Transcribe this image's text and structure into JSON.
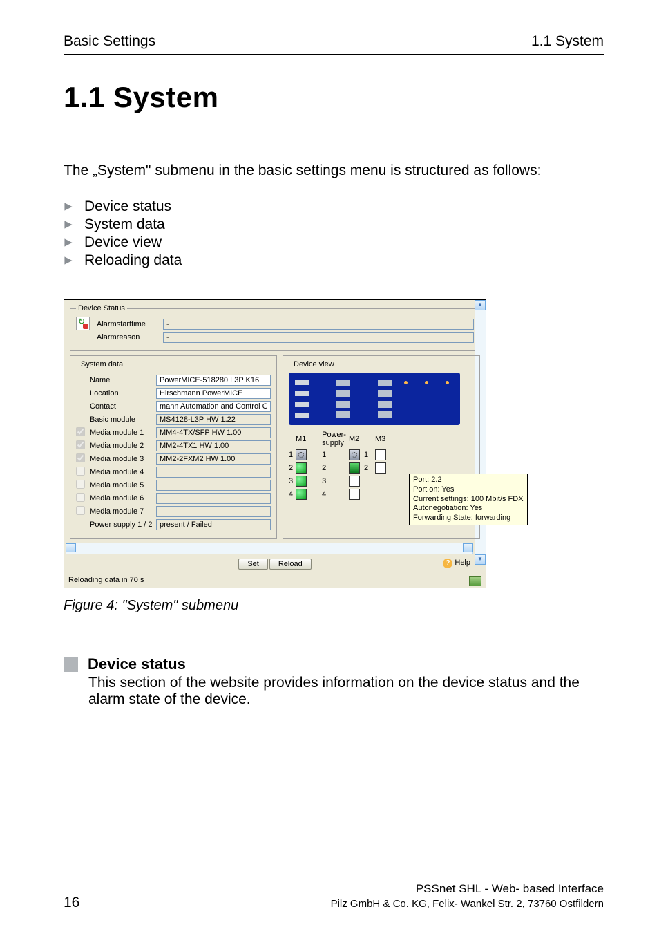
{
  "header": {
    "left": "Basic Settings",
    "right": "1.1 System"
  },
  "title": "1.1  System",
  "intro": "The „System\" submenu in the basic settings menu is structured as follows:",
  "bullets": [
    "Device status",
    "System data",
    "Device view",
    "Reloading data"
  ],
  "caption": "Figure 4:   \"System\" submenu",
  "section": {
    "heading": "Device status",
    "body": "This section of the website provides information on the device status and the alarm state of the device."
  },
  "footer": {
    "page": "16",
    "doc_title": "PSSnet SHL - Web- based Interface",
    "publisher": "Pilz GmbH & Co. KG, Felix- Wankel Str. 2, 73760 Ostfildern"
  },
  "screenshot": {
    "device_status_legend": "Device Status",
    "alarm_time_label": "Alarmstarttime",
    "alarm_time_value": "-",
    "alarm_reason_label": "Alarmreason",
    "alarm_reason_value": "-",
    "system_data_legend": "System data",
    "device_view_legend": "Device view",
    "fields": {
      "name_label": "Name",
      "name_value": "PowerMICE-518280 L3P K16",
      "location_label": "Location",
      "location_value": "Hirschmann PowerMICE",
      "contact_label": "Contact",
      "contact_value": "mann Automation and Control GmbH",
      "basic_label": "Basic module",
      "basic_value": "MS4128-L3P HW 1.22"
    },
    "modules": [
      {
        "checked": true,
        "label": "Media module 1",
        "value": "MM4-4TX/SFP HW 1.00"
      },
      {
        "checked": true,
        "label": "Media module 2",
        "value": "MM2-4TX1 HW 1.00"
      },
      {
        "checked": true,
        "label": "Media module 3",
        "value": "MM2-2FXM2 HW 1.00"
      },
      {
        "checked": false,
        "label": "Media module 4",
        "value": ""
      },
      {
        "checked": false,
        "label": "Media module 5",
        "value": ""
      },
      {
        "checked": false,
        "label": "Media module 6",
        "value": ""
      },
      {
        "checked": false,
        "label": "Media module 7",
        "value": ""
      }
    ],
    "power_label": "Power supply 1 / 2",
    "power_value": "present / Failed",
    "port_headers": {
      "m1": "M1",
      "power": "Power-\nsupply",
      "m2": "M2",
      "m3": "M3"
    },
    "tooltip": {
      "l1": "Port: 2.2",
      "l2": "Port on: Yes",
      "l3": "Current settings: 100 Mbit/s FDX",
      "l4": "Autonegotiation: Yes",
      "l5": "Forwarding State: forwarding"
    },
    "buttons": {
      "set": "Set",
      "reload": "Reload",
      "help": "Help"
    },
    "reloading": "Reloading data in 70 s"
  }
}
